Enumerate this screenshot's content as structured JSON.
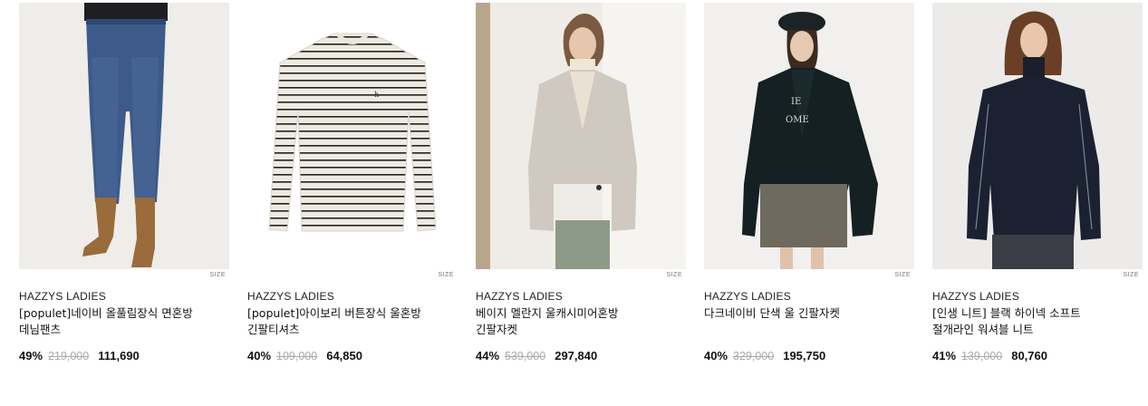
{
  "products": [
    {
      "brand": "HAZZYS LADIES",
      "name": "[populet]네이비 올풀림장식 면혼방 데님팬츠",
      "discount": "49%",
      "original_price": "219,000",
      "sale_price": "111,690",
      "size_label": "SIZE",
      "image": "navy-denim-pants-photo"
    },
    {
      "brand": "HAZZYS LADIES",
      "name": "[populet]아이보리 버튼장식 울혼방 긴팔티셔츠",
      "discount": "40%",
      "original_price": "109,000",
      "sale_price": "64,850",
      "size_label": "SIZE",
      "image": "ivory-striped-tshirt-photo"
    },
    {
      "brand": "HAZZYS LADIES",
      "name": "베이지 멜란지 울캐시미어혼방 긴팔자켓",
      "discount": "44%",
      "original_price": "539,000",
      "sale_price": "297,840",
      "size_label": "SIZE",
      "image": "beige-cashmere-jacket-photo"
    },
    {
      "brand": "HAZZYS LADIES",
      "name": "다크네이비 단색 울 긴팔자켓",
      "discount": "40%",
      "original_price": "329,000",
      "sale_price": "195,750",
      "size_label": "SIZE",
      "image": "dark-navy-wool-jacket-photo"
    },
    {
      "brand": "HAZZYS LADIES",
      "name": "[인생 니트] 블랙 하이넥 소프트 절개라인 워셔블 니트",
      "discount": "41%",
      "original_price": "139,000",
      "sale_price": "80,760",
      "size_label": "SIZE",
      "image": "black-highneck-knit-photo"
    }
  ]
}
